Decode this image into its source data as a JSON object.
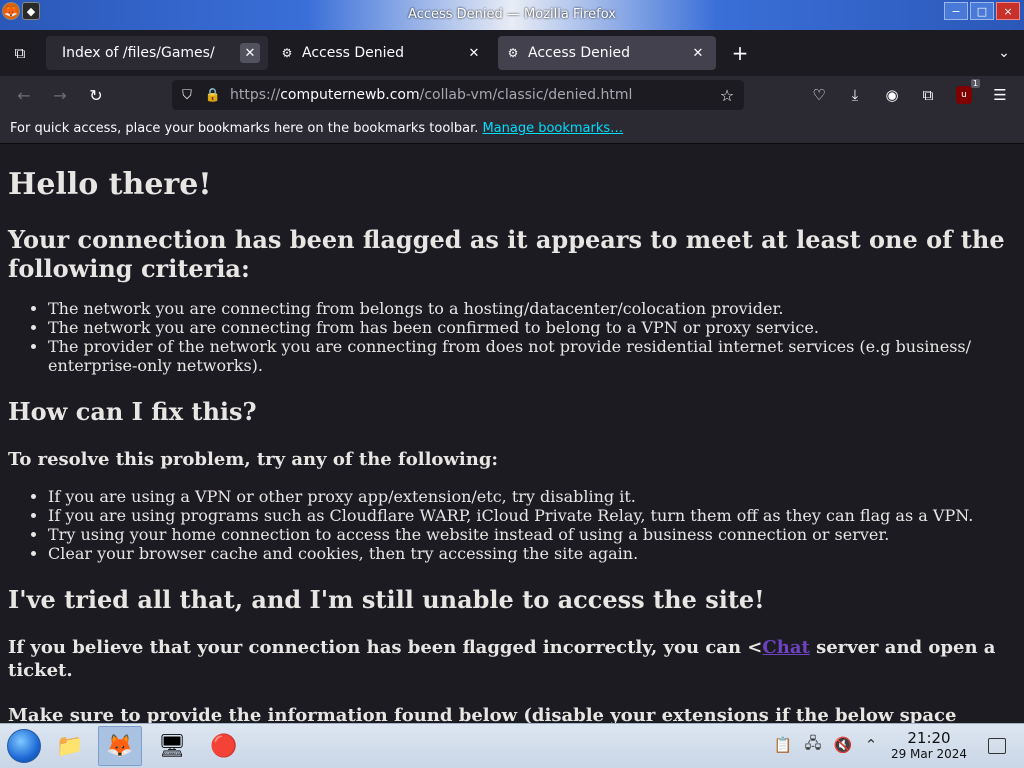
{
  "window": {
    "title": "Access Denied — Mozilla Firefox",
    "min": "−",
    "max": "□",
    "close": "×"
  },
  "tabs": [
    {
      "title": "Index of /files/Games/",
      "active": false,
      "hovered": true
    },
    {
      "title": "Access Denied",
      "active": false
    },
    {
      "title": "Access Denied",
      "active": true
    }
  ],
  "navbar": {
    "url_scheme": "https://",
    "url_domain": "computernewb.com",
    "url_path": "/collab-vm/classic/denied.html",
    "extension_badge": "1"
  },
  "bookmarks": {
    "message": "For quick access, place your bookmarks here on the bookmarks toolbar.",
    "link": "Manage bookmarks…"
  },
  "page": {
    "h1": "Hello there!",
    "h2_flagged": "Your connection has been flagged as it appears to meet at least one of the following criteria:",
    "criteria": [
      "The network you are connecting from belongs to a hosting/datacenter/colocation provider.",
      "The network you are connecting from has been confirmed to belong to a VPN or proxy service.",
      "The provider of the network you are connecting from does not provide residential internet services (e.g business/ enterprise-only networks)."
    ],
    "h2_fix": "How can I fix this?",
    "h3_resolve": "To resolve this problem, try any of the following:",
    "fixes": [
      "If you are using a VPN or other proxy app/extension/etc, try disabling it.",
      "If you are using programs such as Cloudflare WARP, iCloud Private Relay, turn them off as they can flag as a VPN.",
      "Try using your home connection to access the website instead of using a business connection or server.",
      "Clear your browser cache and cookies, then try accessing the site again."
    ],
    "h2_tried": "I've tried all that, and I'm still unable to access the site!",
    "h3_believe_pre": "If you believe that your connection has been flagged incorrectly, you can <",
    "h3_believe_link": "Chat",
    "h3_believe_post": " server and open a ticket.",
    "h3_provide": "Make sure to provide the information found below (disable your extensions if the below space"
  },
  "taskbar": {
    "time": "21:20",
    "date": "29 Mar 2024"
  }
}
